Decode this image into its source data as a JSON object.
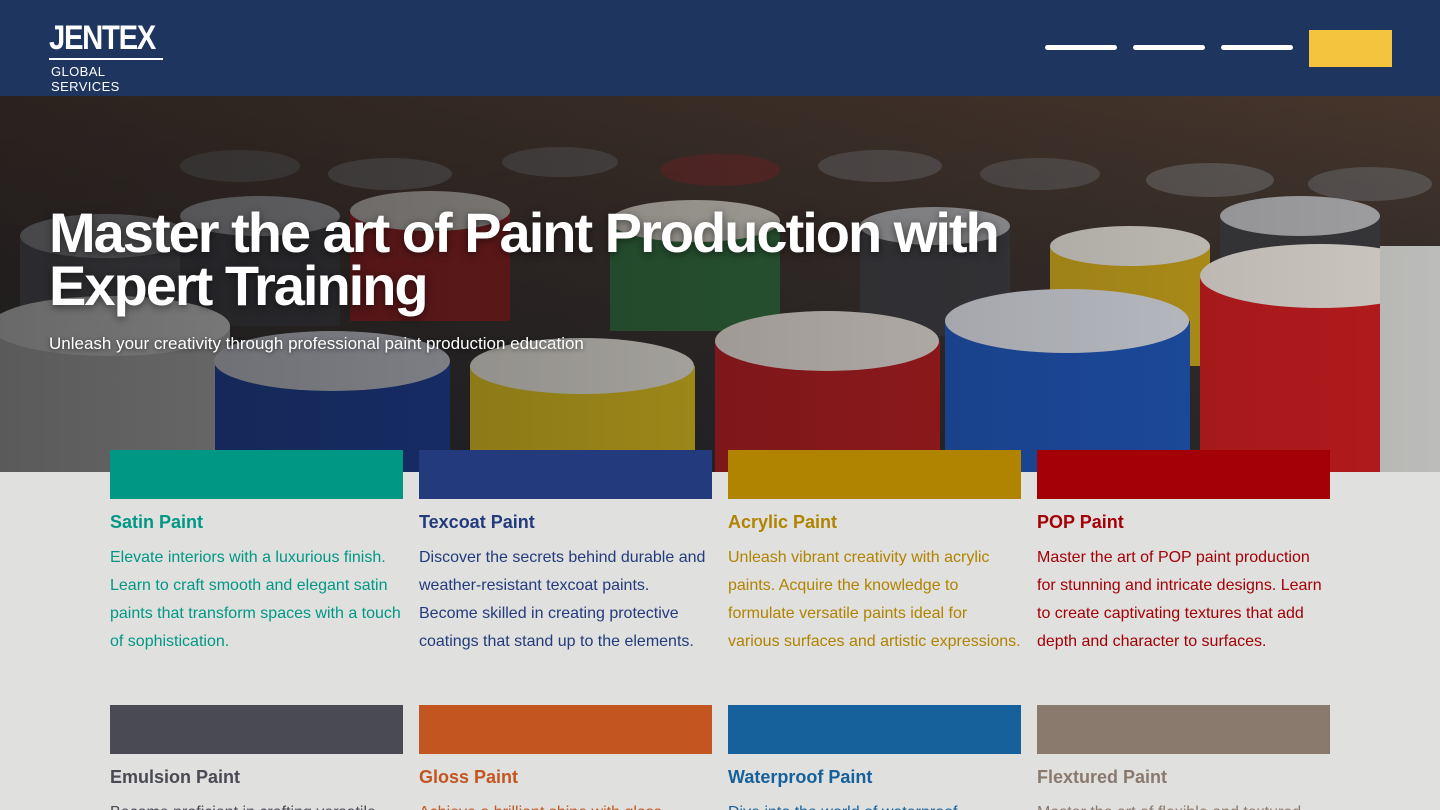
{
  "brand": {
    "name": "JENTEX",
    "tagline": "GLOBAL SERVICES"
  },
  "header": {
    "background_color": "#1e3560",
    "nav": [
      {
        "icon": "menu-line"
      },
      {
        "icon": "menu-line"
      },
      {
        "icon": "menu-line"
      }
    ],
    "cta_color": "#f5c43e"
  },
  "hero": {
    "title": "Master the art of Paint Production with Expert Training",
    "subtitle": "Unleash your creativity through professional paint production education"
  },
  "courses": [
    {
      "title": "Satin Paint",
      "color": "#009885",
      "description": "Elevate interiors with a luxurious finish. Learn to craft smooth and elegant satin paints that transform spaces with a touch of sophistication."
    },
    {
      "title": "Texcoat Paint",
      "color": "#233b7c",
      "description": "Discover the secrets behind durable and weather-resistant texcoat paints. Become skilled in creating protective coatings that stand up to the elements."
    },
    {
      "title": "Acrylic Paint",
      "color": "#b08300",
      "description": "Unleash vibrant creativity with acrylic paints. Acquire the knowledge to formulate versatile paints ideal for various surfaces and artistic expressions."
    },
    {
      "title": "POP Paint",
      "color": "#a30007",
      "description": "Master the art of POP paint production for stunning and intricate designs. Learn to create captivating textures that add depth and character to surfaces."
    },
    {
      "title": "Emulsion Paint",
      "color": "#4a4a55",
      "description": "Become proficient in crafting versatile"
    },
    {
      "title": "Gloss Paint",
      "color": "#c25520",
      "description": "Achieve a brilliant shine with gloss"
    },
    {
      "title": "Waterproof Paint",
      "color": "#16609c",
      "description": "Dive into the world of waterproof"
    },
    {
      "title": "Flextured Paint",
      "color": "#8a7a6e",
      "description": "Master the art of flexible and textured"
    }
  ]
}
